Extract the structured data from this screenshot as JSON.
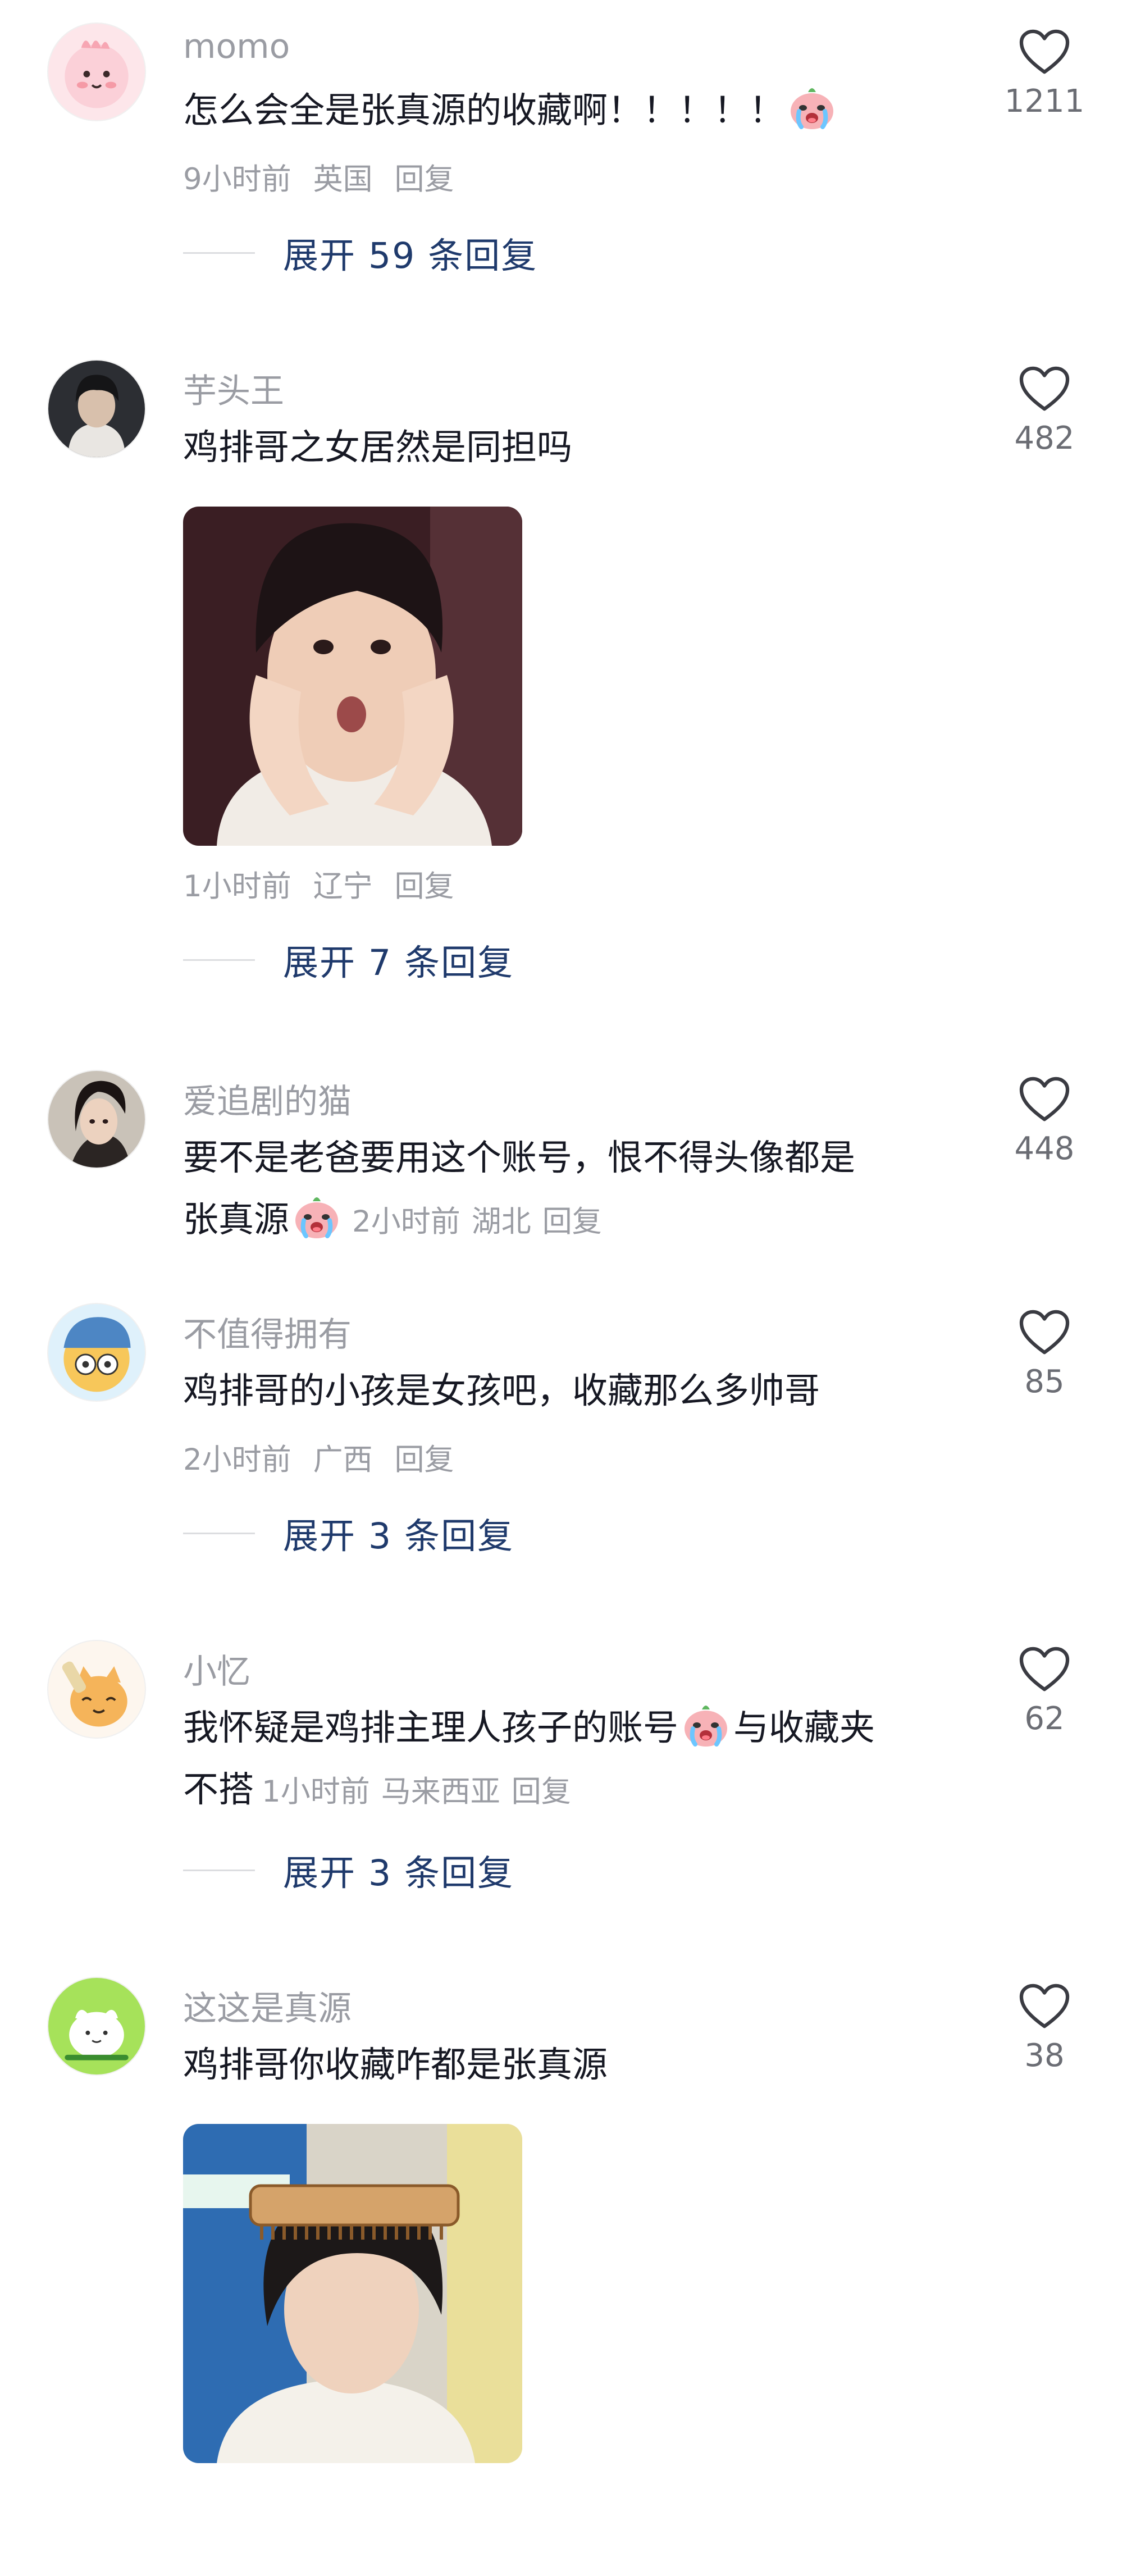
{
  "comments": [
    {
      "username": "momo",
      "text": "怎么会全是张真源的收藏啊！！！！！",
      "emoji": "crying-face-emoji",
      "time": "9小时前",
      "location": "英国",
      "reply": "回复",
      "likes": "1211",
      "expand": "展开 59 条回复"
    },
    {
      "username": "芋头王",
      "text": "鸡排哥之女居然是同担吗",
      "time": "1小时前",
      "location": "辽宁",
      "reply": "回复",
      "likes": "482",
      "expand": "展开 7 条回复"
    },
    {
      "username": "爱追剧的猫",
      "text_line1": "要不是老爸要用这个账号，恨不得头像都是",
      "text_line2": "张真源",
      "emoji": "crying-face-emoji",
      "time": "2小时前",
      "location": "湖北",
      "reply": "回复",
      "likes": "448"
    },
    {
      "username": "不值得拥有",
      "text": "鸡排哥的小孩是女孩吧，收藏那么多帅哥",
      "time": "2小时前",
      "location": "广西",
      "reply": "回复",
      "likes": "85",
      "expand": "展开 3 条回复"
    },
    {
      "username": "小忆",
      "text_part1": "我怀疑是鸡排主理人孩子的账号",
      "text_part2": "与收藏夹",
      "text_line2": "不搭",
      "emoji": "crying-face-emoji",
      "time": "1小时前",
      "location": "马来西亚",
      "reply": "回复",
      "likes": "62",
      "expand": "展开 3 条回复"
    },
    {
      "username": "这这是真源",
      "text": "鸡排哥你收藏咋都是张真源",
      "likes": "38"
    }
  ],
  "colors": {
    "username": "#9a9ca3",
    "text": "#161823",
    "meta": "#9a9ca3",
    "expand": "#1f3a6c",
    "like_count": "#6b6d74"
  },
  "icons": {
    "like": "heart-outline-icon"
  }
}
